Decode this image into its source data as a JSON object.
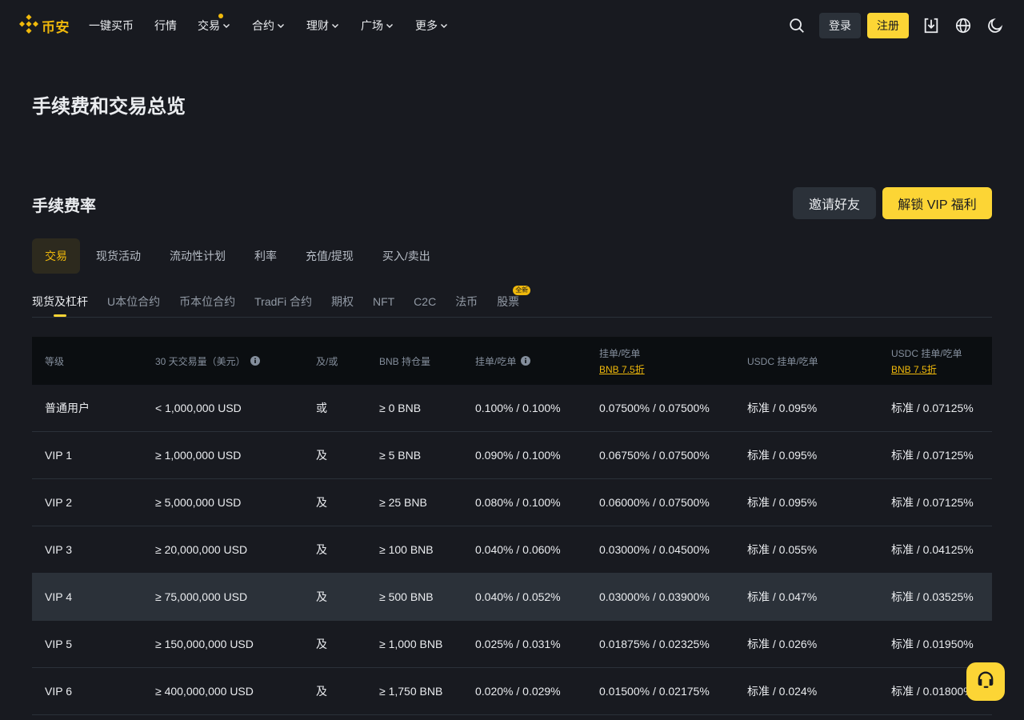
{
  "header": {
    "logo_text": "币安",
    "nav": [
      {
        "label": "一键买币",
        "dropdown": false,
        "dot": false
      },
      {
        "label": "行情",
        "dropdown": false,
        "dot": false
      },
      {
        "label": "交易",
        "dropdown": true,
        "dot": true
      },
      {
        "label": "合约",
        "dropdown": true,
        "dot": false
      },
      {
        "label": "理财",
        "dropdown": true,
        "dot": false
      },
      {
        "label": "广场",
        "dropdown": true,
        "dot": false
      },
      {
        "label": "更多",
        "dropdown": true,
        "dot": false
      }
    ],
    "login_label": "登录",
    "register_label": "注册"
  },
  "page": {
    "title": "手续费和交易总览",
    "section_title": "手续费率",
    "invite_label": "邀请好友",
    "vip_label": "解锁 VIP 福利"
  },
  "tabs_primary": [
    {
      "label": "交易",
      "active": true
    },
    {
      "label": "现货活动",
      "active": false
    },
    {
      "label": "流动性计划",
      "active": false
    },
    {
      "label": "利率",
      "active": false
    },
    {
      "label": "充值/提现",
      "active": false
    },
    {
      "label": "买入/卖出",
      "active": false
    }
  ],
  "tabs_secondary": [
    {
      "label": "现货及杠杆",
      "active": true
    },
    {
      "label": "U本位合约",
      "active": false
    },
    {
      "label": "币本位合约",
      "active": false
    },
    {
      "label": "TradFi 合约",
      "active": false
    },
    {
      "label": "期权",
      "active": false
    },
    {
      "label": "NFT",
      "active": false
    },
    {
      "label": "C2C",
      "active": false
    },
    {
      "label": "法币",
      "active": false
    },
    {
      "label": "股票",
      "active": false,
      "badge": "全新"
    }
  ],
  "table": {
    "headers": {
      "level": "等级",
      "volume": "30 天交易量（美元）",
      "andor": "及/或",
      "bnb": "BNB 持仓量",
      "maker_taker": "挂单/吃单",
      "maker_taker_bnb": "挂单/吃单",
      "maker_taker_bnb_sub": "BNB 7.5折",
      "usdc": "USDC 挂单/吃单",
      "usdc_bnb": "USDC 挂单/吃单",
      "usdc_bnb_sub": "BNB 7.5折"
    },
    "rows": [
      [
        "普通用户",
        "< 1,000,000 USD",
        "或",
        "≥ 0 BNB",
        "0.100% / 0.100%",
        "0.07500% / 0.07500%",
        "标准 / 0.095%",
        "标准 / 0.07125%"
      ],
      [
        "VIP 1",
        "≥ 1,000,000 USD",
        "及",
        "≥ 5 BNB",
        "0.090% / 0.100%",
        "0.06750% / 0.07500%",
        "标准 / 0.095%",
        "标准 / 0.07125%"
      ],
      [
        "VIP 2",
        "≥ 5,000,000 USD",
        "及",
        "≥ 25 BNB",
        "0.080% / 0.100%",
        "0.06000% / 0.07500%",
        "标准 / 0.095%",
        "标准 / 0.07125%"
      ],
      [
        "VIP 3",
        "≥ 20,000,000 USD",
        "及",
        "≥ 100 BNB",
        "0.040% / 0.060%",
        "0.03000% / 0.04500%",
        "标准 / 0.055%",
        "标准 / 0.04125%"
      ],
      [
        "VIP 4",
        "≥ 75,000,000 USD",
        "及",
        "≥ 500 BNB",
        "0.040% / 0.052%",
        "0.03000% / 0.03900%",
        "标准 / 0.047%",
        "标准 / 0.03525%"
      ],
      [
        "VIP 5",
        "≥ 150,000,000 USD",
        "及",
        "≥ 1,000 BNB",
        "0.025% / 0.031%",
        "0.01875% / 0.02325%",
        "标准 / 0.026%",
        "标准 / 0.01950%"
      ],
      [
        "VIP 6",
        "≥ 400,000,000 USD",
        "及",
        "≥ 1,750 BNB",
        "0.020% / 0.029%",
        "0.01500% / 0.02175%",
        "标准 / 0.024%",
        "标准 / 0.01800%"
      ]
    ],
    "highlighted_row": 4
  },
  "colors": {
    "background": "#181a20",
    "accent": "#fcd535",
    "brand": "#f0b90b",
    "text": "#eaecef",
    "muted": "#848e9c"
  },
  "icons": [
    "binance-logo-icon",
    "chevron-down-icon",
    "search-icon",
    "download-icon",
    "globe-icon",
    "moon-icon",
    "info-icon",
    "headset-icon"
  ]
}
